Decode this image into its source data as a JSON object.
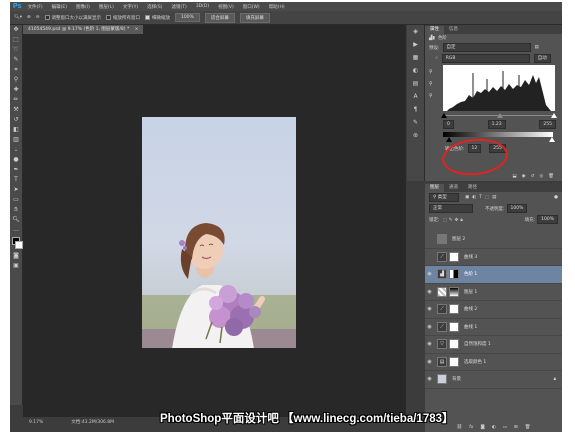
{
  "app": {
    "logo": "Ps"
  },
  "menu": [
    "文件(F)",
    "编辑(E)",
    "图像(I)",
    "图层(L)",
    "文字(Y)",
    "选择(S)",
    "滤镜(T)",
    "3D(D)",
    "视图(V)",
    "窗口(W)",
    "帮助(H)"
  ],
  "options": {
    "resize_label": "调整窗口大小以满屏显示",
    "zoom_all_label": "缩放所有窗口",
    "scrubby_label": "细微缩放",
    "btn_100": "100%",
    "btn_fit": "适合屏幕",
    "btn_fill": "填充屏幕"
  },
  "document": {
    "tab_title": "41054549.psd @ 9.17% (色阶 1, 图层蒙版/8) *",
    "zoom": "9.17%",
    "doc_size": "文档:43.2M/306.8M"
  },
  "properties": {
    "tabs": [
      "属性",
      "信息"
    ],
    "adjustment_name": "色阶",
    "preset_label": "预设:",
    "preset_value": "自定",
    "channel_value": "RGB",
    "auto_button": "自动",
    "input_black": "0",
    "input_gamma": "1.23",
    "input_white": "255",
    "output_label": "输出色阶:",
    "output_black": "12",
    "output_white": "255"
  },
  "layers_panel": {
    "tabs": [
      "图层",
      "通道",
      "路径"
    ],
    "filter_kind": "类型",
    "blend_mode": "正常",
    "opacity_label": "不透明度:",
    "opacity_value": "100%",
    "lock_label": "锁定:",
    "fill_label": "填充:",
    "fill_value": "100%",
    "layers": [
      {
        "name": "图层 2",
        "eye": false,
        "thumb": "",
        "mask": false,
        "selected": false
      },
      {
        "name": "曲线 3",
        "eye": false,
        "thumb": "⟋",
        "mask": true,
        "selected": false
      },
      {
        "name": "色阶 1",
        "eye": true,
        "thumb": "▟",
        "mask": true,
        "selected": true
      },
      {
        "name": "图层 1",
        "eye": true,
        "thumb": "▦",
        "mask": true,
        "selected": false
      },
      {
        "name": "曲线 2",
        "eye": true,
        "thumb": "⟋",
        "mask": true,
        "selected": false
      },
      {
        "name": "曲线 1",
        "eye": true,
        "thumb": "⟋",
        "mask": true,
        "selected": false
      },
      {
        "name": "自然饱和度 1",
        "eye": true,
        "thumb": "▽",
        "mask": true,
        "selected": false
      },
      {
        "name": "选取颜色 1",
        "eye": true,
        "thumb": "▤",
        "mask": true,
        "selected": false
      },
      {
        "name": "背景",
        "eye": true,
        "thumb": "",
        "mask": false,
        "selected": false
      }
    ]
  },
  "watermark": "PhotoShop平面设计吧 【www.linecg.com/tieba/1783】",
  "colors": {
    "annotation": "#e32222",
    "selected_layer": "#6d84a2",
    "ps_blue": "#31a8ff"
  }
}
